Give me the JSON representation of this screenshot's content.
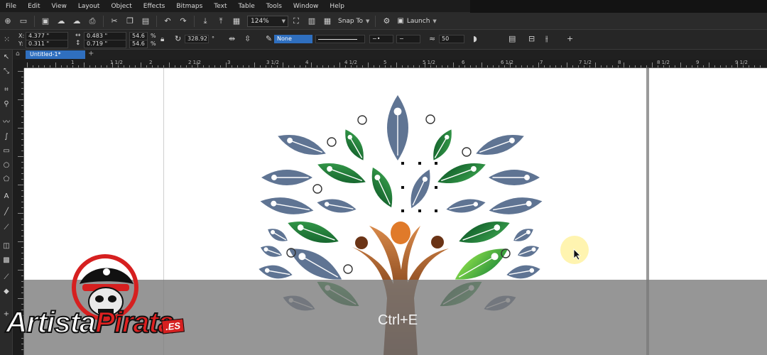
{
  "menubar": {
    "items": [
      "File",
      "Edit",
      "View",
      "Layout",
      "Object",
      "Effects",
      "Bitmaps",
      "Text",
      "Table",
      "Tools",
      "Window",
      "Help"
    ]
  },
  "toolbar": {
    "zoom": "124%",
    "snap_to": "Snap To",
    "launch": "Launch"
  },
  "propbar": {
    "x": "4.377 \"",
    "y": "0.311 \"",
    "w": "0.483 \"",
    "h": "0.719 \"",
    "scale_w": "54.6",
    "scale_h": "54.6",
    "pct1": "%",
    "pct2": "%",
    "rotation": "328.92",
    "outline": "None",
    "smooth": "50"
  },
  "labels": {
    "x": "X:",
    "y": "Y:"
  },
  "document": {
    "tab_title": "Untitled-1*"
  },
  "ruler": {
    "labels": [
      "1",
      "1 1/2",
      "2",
      "2 1/2",
      "3",
      "3 1/2",
      "4",
      "4 1/2",
      "5",
      "5 1/2",
      "6",
      "6 1/2",
      "7",
      "7 1/2",
      "8",
      "8 1/2",
      "9",
      "9 1/2",
      "10"
    ]
  },
  "overlay": {
    "shortcut": "Ctrl+E"
  },
  "watermark": {
    "word1": "Artista",
    "word2": "Pirata",
    "suffix": ".ES"
  },
  "colors": {
    "leaf_blue": "#5f7493",
    "leaf_green": "#1e7a3a",
    "trunk": "#6b3416",
    "orange": "#e07a2a",
    "menu_bg": "#1c1c1c",
    "tab_blue": "#2f6fbf"
  }
}
